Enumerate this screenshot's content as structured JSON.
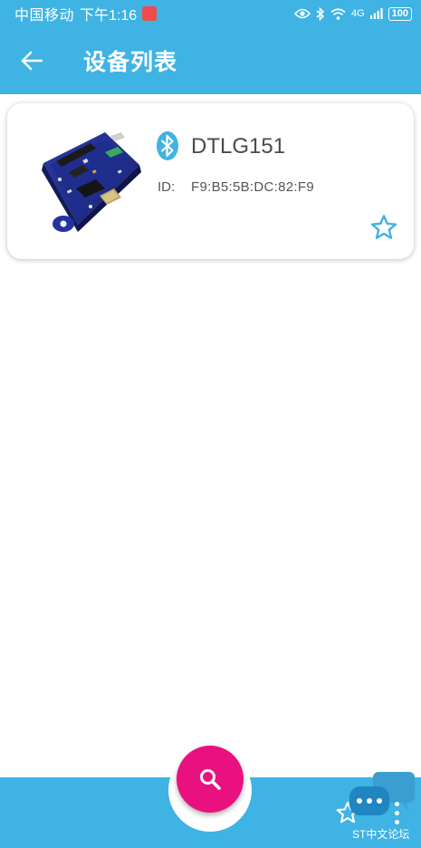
{
  "status_bar": {
    "carrier": "中国移动",
    "time": "下午1:16",
    "network": "4G",
    "battery": "100"
  },
  "app_bar": {
    "title": "设备列表"
  },
  "device_list": [
    {
      "name": "DTLG151",
      "id_label": "ID:",
      "id_value": "F9:B5:5B:DC:82:F9"
    }
  ],
  "watermark": "ST中文论坛",
  "colors": {
    "primary": "#3fb3e3",
    "fab": "#e8117f",
    "bluetooth": "#3fb3e3",
    "star": "#3fb3e3"
  },
  "icons": {
    "back": "arrow-left-icon",
    "bluetooth": "bluetooth-icon",
    "favorite": "star-outline-icon",
    "search": "search-icon",
    "more": "more-vert-icon",
    "chat": "chat-bubble-icon"
  }
}
